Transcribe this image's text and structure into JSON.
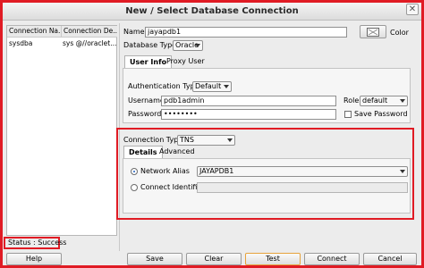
{
  "window": {
    "title": "New / Select Database Connection",
    "close_glyph": "✕"
  },
  "connections": {
    "columns": [
      "Connection Na...",
      "Connection De..."
    ],
    "rows": [
      {
        "name": "sysdba",
        "details": "sys @//oraclet..."
      }
    ]
  },
  "form": {
    "name_label": "Name",
    "name_value": "jayapdb1",
    "color_label": "Color",
    "db_type_label": "Database Type",
    "db_type_value": "Oracle",
    "tabs": [
      "User Info",
      "Proxy User"
    ],
    "auth_type_label": "Authentication Type",
    "auth_type_value": "Default",
    "username_label": "Username",
    "username_value": "pdb1admin",
    "role_label": "Role",
    "role_value": "default",
    "password_label": "Password",
    "password_value": "••••••••",
    "save_password_label": "Save Password",
    "connection_type_label": "Connection Type",
    "connection_type_value": "TNS",
    "sub_tabs": [
      "Details",
      "Advanced"
    ],
    "network_alias_label": "Network Alias",
    "network_alias_value": "JAYAPDB1",
    "connect_identifier_label": "Connect Identifier",
    "connect_identifier_value": ""
  },
  "status": {
    "text": "Status : Success"
  },
  "buttons": {
    "help": "Help",
    "save": "Save",
    "clear": "Clear",
    "test": "Test",
    "connect": "Connect",
    "cancel": "Cancel"
  },
  "colors": {
    "highlight": "#e01b24",
    "default_button_border": "#e6a23c",
    "radio_dot": "#1f5fbf"
  }
}
